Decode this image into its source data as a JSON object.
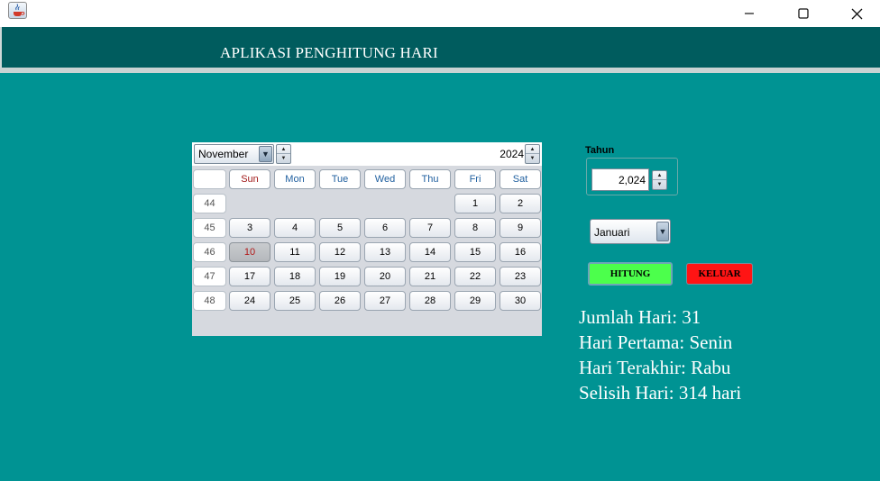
{
  "window": {
    "title": "",
    "controls": {
      "minimize_icon": "minimize-icon",
      "maximize_icon": "maximize-icon",
      "close_icon": "close-icon"
    }
  },
  "header": {
    "title": "APLIKASI PENGHITUNG HARI"
  },
  "calendar": {
    "month": "November",
    "year": "2024",
    "day_names": [
      "Sun",
      "Mon",
      "Tue",
      "Wed",
      "Thu",
      "Fri",
      "Sat"
    ],
    "weeks": [
      {
        "week": "44",
        "days": [
          "",
          "",
          "",
          "",
          "",
          "1",
          "2"
        ]
      },
      {
        "week": "45",
        "days": [
          "3",
          "4",
          "5",
          "6",
          "7",
          "8",
          "9"
        ]
      },
      {
        "week": "46",
        "days": [
          "10",
          "11",
          "12",
          "13",
          "14",
          "15",
          "16"
        ]
      },
      {
        "week": "47",
        "days": [
          "17",
          "18",
          "19",
          "20",
          "21",
          "22",
          "23"
        ]
      },
      {
        "week": "48",
        "days": [
          "24",
          "25",
          "26",
          "27",
          "28",
          "29",
          "30"
        ]
      }
    ],
    "selected_day": "10"
  },
  "form": {
    "tahun_label": "Tahun",
    "tahun_value": "2,024",
    "bulan_value": "Januari",
    "hitung_label": "HITUNG",
    "keluar_label": "KELUAR"
  },
  "colors": {
    "background": "#009393",
    "header": "#005c5e",
    "hitung_button": "#4cff4c",
    "keluar_button": "#ff1414"
  },
  "results": {
    "jumlah_hari": "Jumlah Hari: 31",
    "hari_pertama": "Hari Pertama: Senin",
    "hari_terakhir": "Hari Terakhir: Rabu",
    "selisih_hari": "Selisih Hari: 314 hari"
  }
}
